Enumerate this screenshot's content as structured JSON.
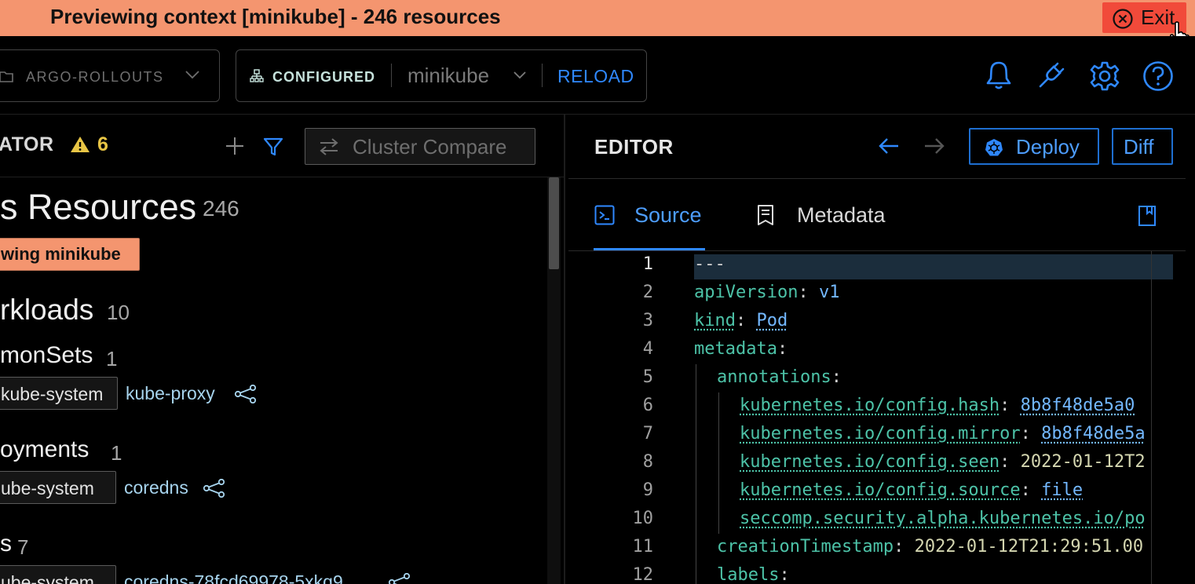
{
  "banner": {
    "text": "Previewing context [minikube] - 246 resources",
    "exit_label": "Exit",
    "color": "#f4956f",
    "exit_color": "#f14a3a"
  },
  "header": {
    "project_label": "ARGO-ROLLOUTS",
    "cluster_status": "CONFIGURED",
    "context_name": "minikube",
    "reload_label": "RELOAD",
    "icons": [
      "bell-icon",
      "plug-icon",
      "gear-icon",
      "help-icon"
    ]
  },
  "navigator": {
    "title": "ATOR",
    "warning_count": "6",
    "compare_label": "Cluster Compare",
    "resources_title": "s Resources",
    "resources_count": "246",
    "preview_tag": "wing minikube",
    "sections": [
      {
        "title": "rkloads",
        "count": "10",
        "kinds": [
          {
            "name": "monSets",
            "count": "1",
            "items": [
              {
                "namespace": "kube-system",
                "name": "kube-proxy"
              }
            ]
          },
          {
            "name": "oyments",
            "count": "1",
            "items": [
              {
                "namespace": "ube-system",
                "name": "coredns"
              }
            ]
          },
          {
            "name": "s",
            "count": "7",
            "items": [
              {
                "namespace": "ube-system",
                "name": "coredns-78fcd69978-5xkq9"
              }
            ]
          }
        ]
      }
    ]
  },
  "editor": {
    "title": "EDITOR",
    "deploy_label": "Deploy",
    "diff_label": "Diff",
    "tabs": [
      {
        "label": "Source",
        "active": true
      },
      {
        "label": "Metadata",
        "active": false
      }
    ],
    "lines": [
      {
        "n": "1",
        "indent": 0,
        "parts": [
          {
            "t": "---",
            "c": "p"
          }
        ]
      },
      {
        "n": "2",
        "indent": 0,
        "parts": [
          {
            "t": "apiVersion",
            "c": "k"
          },
          {
            "t": ": ",
            "c": "p"
          },
          {
            "t": "v1",
            "c": "vb"
          }
        ]
      },
      {
        "n": "3",
        "indent": 0,
        "parts": [
          {
            "t": "kind",
            "c": "kd"
          },
          {
            "t": ": ",
            "c": "p"
          },
          {
            "t": "Pod",
            "c": "vbd"
          }
        ]
      },
      {
        "n": "4",
        "indent": 0,
        "parts": [
          {
            "t": "metadata",
            "c": "k"
          },
          {
            "t": ":",
            "c": "p"
          }
        ]
      },
      {
        "n": "5",
        "indent": 1,
        "parts": [
          {
            "t": "annotations",
            "c": "k"
          },
          {
            "t": ":",
            "c": "p"
          }
        ]
      },
      {
        "n": "6",
        "indent": 2,
        "parts": [
          {
            "t": "kubernetes.io/config.hash",
            "c": "kd"
          },
          {
            "t": ": ",
            "c": "p"
          },
          {
            "t": "8b8f48de5a0",
            "c": "vbd"
          }
        ]
      },
      {
        "n": "7",
        "indent": 2,
        "parts": [
          {
            "t": "kubernetes.io/config.mirror",
            "c": "kd"
          },
          {
            "t": ": ",
            "c": "p"
          },
          {
            "t": "8b8f48de5a",
            "c": "vbd"
          }
        ]
      },
      {
        "n": "8",
        "indent": 2,
        "parts": [
          {
            "t": "kubernetes.io/config.seen",
            "c": "kd"
          },
          {
            "t": ": ",
            "c": "p"
          },
          {
            "t": "2022-01-12T2",
            "c": "vy"
          }
        ]
      },
      {
        "n": "9",
        "indent": 2,
        "parts": [
          {
            "t": "kubernetes.io/config.source",
            "c": "kd"
          },
          {
            "t": ": ",
            "c": "p"
          },
          {
            "t": "file",
            "c": "vbd"
          }
        ]
      },
      {
        "n": "10",
        "indent": 2,
        "parts": [
          {
            "t": "seccomp.security.alpha.kubernetes.io/po",
            "c": "kd"
          }
        ]
      },
      {
        "n": "11",
        "indent": 1,
        "parts": [
          {
            "t": "creationTimestamp",
            "c": "k"
          },
          {
            "t": ": ",
            "c": "p"
          },
          {
            "t": "2022-01-12T21:29:51.00",
            "c": "vy"
          }
        ]
      },
      {
        "n": "12",
        "indent": 1,
        "parts": [
          {
            "t": "labels",
            "c": "k"
          },
          {
            "t": ":",
            "c": "p"
          }
        ]
      }
    ]
  }
}
